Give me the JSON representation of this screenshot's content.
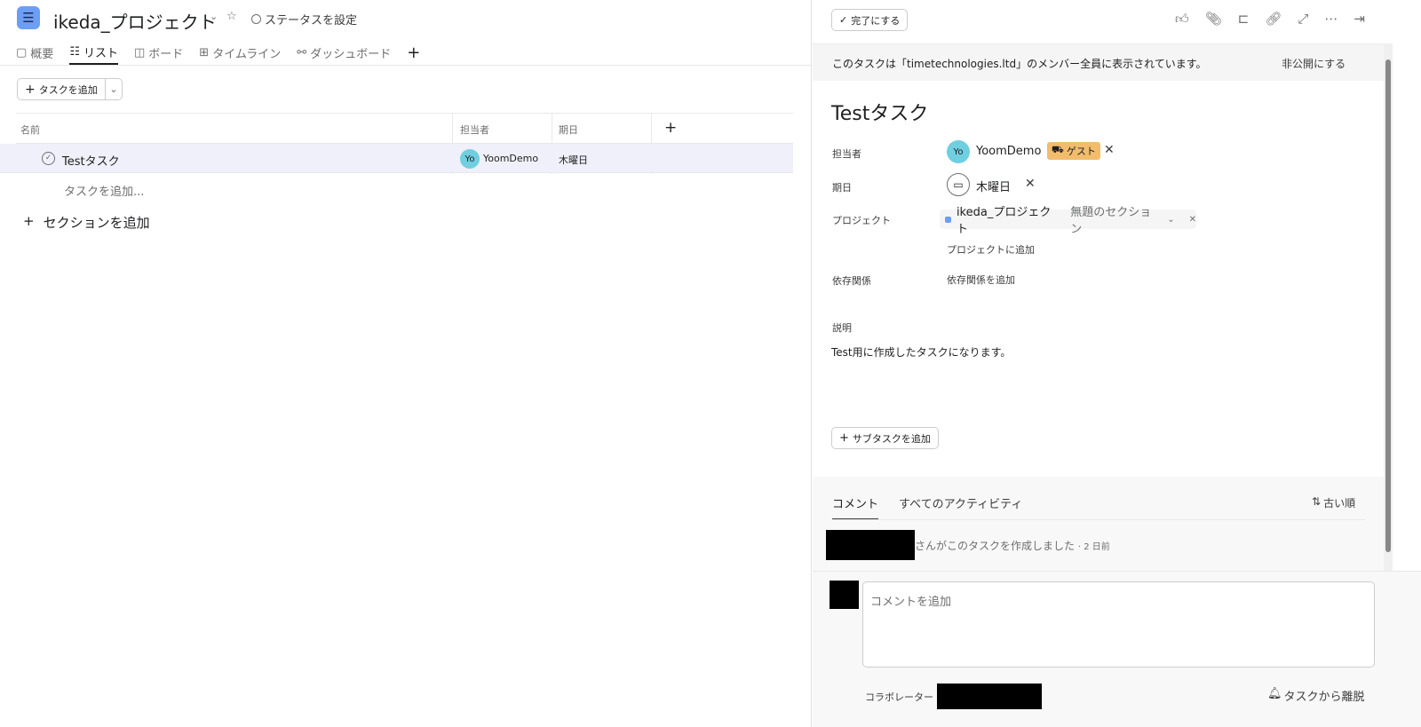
{
  "header": {
    "app_icon": "list-icon",
    "project_title": "ikeda_プロジェクト",
    "status_label": "ステータスを設定"
  },
  "tabs": [
    {
      "label": "概要",
      "icon": "clipboard-icon"
    },
    {
      "label": "リスト",
      "icon": "list-icon"
    },
    {
      "label": "ボード",
      "icon": "board-icon"
    },
    {
      "label": "タイムライン",
      "icon": "timeline-icon"
    },
    {
      "label": "ダッシュボード",
      "icon": "dashboard-icon"
    }
  ],
  "toolbar": {
    "add_task": "タスクを追加"
  },
  "table": {
    "columns": [
      "名前",
      "担当者",
      "期日"
    ],
    "rows": [
      {
        "name": "Testタスク",
        "assignee_initials": "Yo",
        "assignee": "YoomDemo",
        "due": "木曜日"
      }
    ],
    "add_task_inline": "タスクを追加...",
    "add_section": "セクションを追加"
  },
  "detail": {
    "complete_button": "完了にする",
    "visibility_notice": "このタスクは「timetechnologies.ltd」のメンバー全員に表示されています。",
    "make_private": "非公開にする",
    "task_title": "Testタスク",
    "fields": {
      "assignee_label": "担当者",
      "assignee_initials": "Yo",
      "assignee_name": "YoomDemo",
      "guest_badge": "ゲスト",
      "due_label": "期日",
      "due_value": "木曜日",
      "project_label": "プロジェクト",
      "project_name": "ikeda_プロジェクト",
      "section_name": "無題のセクション",
      "add_to_project": "プロジェクトに追加",
      "dependency_label": "依存関係",
      "add_dependency": "依存関係を追加",
      "description_label": "説明",
      "description": "Test用に作成したタスクになります。"
    },
    "add_subtask": "サブタスクを追加",
    "activity": {
      "tab_comments": "コメント",
      "tab_all": "すべてのアクティビティ",
      "sort": "古い順",
      "created_text": "さんがこのタスクを作成しました",
      "created_time": "· 2 日前"
    },
    "comment_placeholder": "コメントを追加",
    "collaborators_label": "コラボレーター",
    "leave_task": "タスクから離脱",
    "colors": {
      "accent": "#6d9ef5",
      "guest": "#f1bd6c",
      "row_highlight": "#f0f0fa"
    }
  }
}
